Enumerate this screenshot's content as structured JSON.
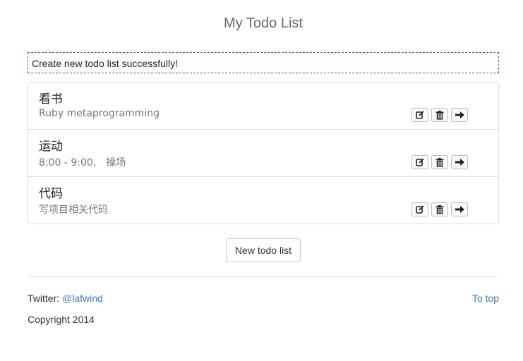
{
  "header": {
    "title": "My Todo List"
  },
  "flash": {
    "message": "Create new todo list successfully!"
  },
  "todos": [
    {
      "title": "看书",
      "description": "Ruby metaprogramming"
    },
    {
      "title": "运动",
      "description": "8:00 - 9:00,　操场"
    },
    {
      "title": "代码",
      "description": "写项目相关代码"
    }
  ],
  "item_actions": {
    "edit_icon": "edit-icon",
    "delete_icon": "trash-icon",
    "open_icon": "arrow-right-icon"
  },
  "new_button": {
    "label": "New todo list"
  },
  "footer": {
    "twitter_label": "Twitter: ",
    "twitter_handle": "@lafwind",
    "to_top": "To top",
    "copyright": "Copyright 2014"
  },
  "colors": {
    "link": "#3a7cc2",
    "flash_border": "#2a7a2a"
  }
}
